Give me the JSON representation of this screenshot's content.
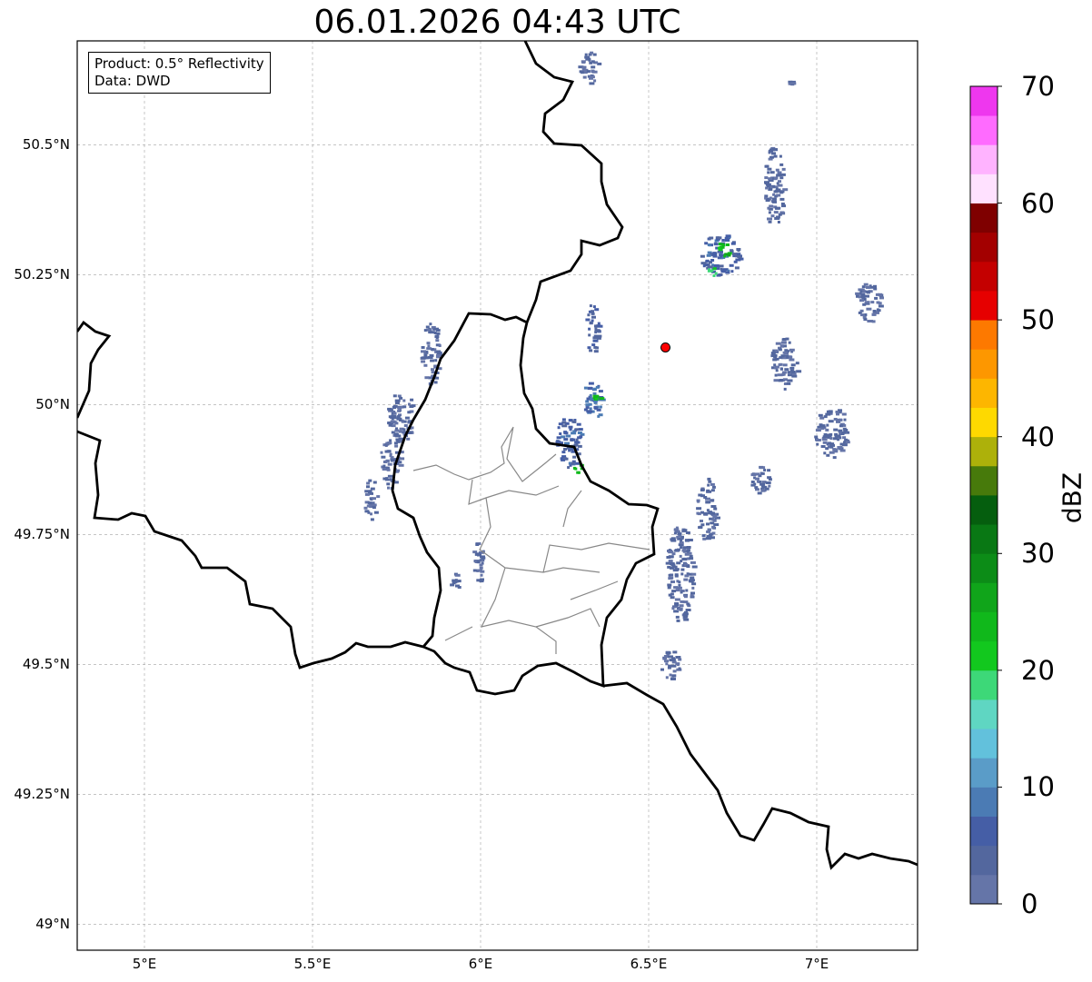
{
  "title": "06.01.2026 04:43 UTC",
  "info_box": {
    "product": "Product: 0.5° Reflectivity",
    "data_source": "Data: DWD"
  },
  "map": {
    "lon_range": [
      4.8,
      7.3
    ],
    "lat_range": [
      48.95,
      50.7
    ],
    "grid": true,
    "lat_ticks": [
      {
        "value": 50.5,
        "label": "50.5°N"
      },
      {
        "value": 50.25,
        "label": "50.25°N"
      },
      {
        "value": 50.0,
        "label": "50°N"
      },
      {
        "value": 49.75,
        "label": "49.75°N"
      },
      {
        "value": 49.5,
        "label": "49.5°N"
      },
      {
        "value": 49.25,
        "label": "49.25°N"
      },
      {
        "value": 49.0,
        "label": "49°N"
      }
    ],
    "lon_ticks": [
      {
        "value": 5.0,
        "label": "5°E"
      },
      {
        "value": 5.5,
        "label": "5.5°E"
      },
      {
        "value": 6.0,
        "label": "6°E"
      },
      {
        "value": 6.5,
        "label": "6.5°E"
      },
      {
        "value": 7.0,
        "label": "7°E"
      }
    ],
    "radar_site": {
      "lon": 6.55,
      "lat": 50.11,
      "color": "#ff0000"
    },
    "echo_regions": [
      {
        "lon": 5.76,
        "lat": 49.98,
        "rlon": 0.04,
        "rlat": 0.05,
        "dbz": 3
      },
      {
        "lon": 5.73,
        "lat": 49.9,
        "rlon": 0.03,
        "rlat": 0.06,
        "dbz": 3
      },
      {
        "lon": 5.67,
        "lat": 49.82,
        "rlon": 0.02,
        "rlat": 0.04,
        "dbz": 3
      },
      {
        "lon": 5.85,
        "lat": 50.1,
        "rlon": 0.03,
        "rlat": 0.06,
        "dbz": 3
      },
      {
        "lon": 5.99,
        "lat": 49.7,
        "rlon": 0.02,
        "rlat": 0.04,
        "dbz": 3
      },
      {
        "lon": 5.92,
        "lat": 49.66,
        "rlon": 0.015,
        "rlat": 0.02,
        "dbz": 3
      },
      {
        "lon": 6.33,
        "lat": 50.15,
        "rlon": 0.02,
        "rlat": 0.05,
        "dbz": 5
      },
      {
        "lon": 6.33,
        "lat": 50.01,
        "rlon": 0.03,
        "rlat": 0.04,
        "dbz": 8
      },
      {
        "lon": 6.26,
        "lat": 49.93,
        "rlon": 0.04,
        "rlat": 0.05,
        "dbz": 6
      },
      {
        "lon": 6.34,
        "lat": 50.02,
        "rlon": 0.015,
        "rlat": 0.01,
        "dbz": 24
      },
      {
        "lon": 6.29,
        "lat": 49.88,
        "rlon": 0.015,
        "rlat": 0.01,
        "dbz": 24
      },
      {
        "lon": 6.71,
        "lat": 50.29,
        "rlon": 0.06,
        "rlat": 0.04,
        "dbz": 6
      },
      {
        "lon": 6.72,
        "lat": 50.3,
        "rlon": 0.02,
        "rlat": 0.015,
        "dbz": 24
      },
      {
        "lon": 6.69,
        "lat": 50.26,
        "rlon": 0.015,
        "rlat": 0.01,
        "dbz": 19
      },
      {
        "lon": 6.87,
        "lat": 50.42,
        "rlon": 0.03,
        "rlat": 0.08,
        "dbz": 3
      },
      {
        "lon": 6.59,
        "lat": 49.68,
        "rlon": 0.04,
        "rlat": 0.1,
        "dbz": 3
      },
      {
        "lon": 6.67,
        "lat": 49.8,
        "rlon": 0.03,
        "rlat": 0.06,
        "dbz": 3
      },
      {
        "lon": 6.56,
        "lat": 49.5,
        "rlon": 0.03,
        "rlat": 0.03,
        "dbz": 3
      },
      {
        "lon": 7.04,
        "lat": 49.95,
        "rlon": 0.05,
        "rlat": 0.05,
        "dbz": 3
      },
      {
        "lon": 6.9,
        "lat": 50.08,
        "rlon": 0.04,
        "rlat": 0.05,
        "dbz": 3
      },
      {
        "lon": 7.15,
        "lat": 50.2,
        "rlon": 0.04,
        "rlat": 0.04,
        "dbz": 3
      },
      {
        "lon": 6.83,
        "lat": 49.86,
        "rlon": 0.03,
        "rlat": 0.03,
        "dbz": 3
      },
      {
        "lon": 6.92,
        "lat": 50.62,
        "rlon": 0.0,
        "rlat": 0.0,
        "dbz": 3
      },
      {
        "lon": 6.32,
        "lat": 50.65,
        "rlon": 0.03,
        "rlat": 0.03,
        "dbz": 3
      }
    ]
  },
  "colorbar": {
    "label": "dBZ",
    "range": [
      0,
      70
    ],
    "tick_values": [
      0,
      10,
      20,
      30,
      40,
      50,
      60,
      70
    ],
    "tick_labels": [
      "0",
      "10",
      "20",
      "30",
      "40",
      "50",
      "60",
      "70"
    ],
    "bins": [
      {
        "min": 0,
        "max": 2.5,
        "color": "#6575a8"
      },
      {
        "min": 2.5,
        "max": 5,
        "color": "#53679e"
      },
      {
        "min": 5,
        "max": 7.5,
        "color": "#455ea6"
      },
      {
        "min": 7.5,
        "max": 10,
        "color": "#4b7bb4"
      },
      {
        "min": 10,
        "max": 12.5,
        "color": "#5a9cc8"
      },
      {
        "min": 12.5,
        "max": 15,
        "color": "#62c1dc"
      },
      {
        "min": 15,
        "max": 17.5,
        "color": "#5fd6c2"
      },
      {
        "min": 17.5,
        "max": 20,
        "color": "#3dd878"
      },
      {
        "min": 20,
        "max": 22.5,
        "color": "#12c81e"
      },
      {
        "min": 22.5,
        "max": 25,
        "color": "#10b81b"
      },
      {
        "min": 25,
        "max": 27.5,
        "color": "#10a51a"
      },
      {
        "min": 27.5,
        "max": 30,
        "color": "#0c8c17"
      },
      {
        "min": 30,
        "max": 32.5,
        "color": "#097814"
      },
      {
        "min": 32.5,
        "max": 35,
        "color": "#055e0e"
      },
      {
        "min": 35,
        "max": 37.5,
        "color": "#477a0b"
      },
      {
        "min": 37.5,
        "max": 40,
        "color": "#adb10a"
      },
      {
        "min": 40,
        "max": 42.5,
        "color": "#fed900"
      },
      {
        "min": 42.5,
        "max": 45,
        "color": "#fdb600"
      },
      {
        "min": 45,
        "max": 47.5,
        "color": "#fd9700"
      },
      {
        "min": 47.5,
        "max": 50,
        "color": "#fd7900"
      },
      {
        "min": 50,
        "max": 52.5,
        "color": "#e60000"
      },
      {
        "min": 52.5,
        "max": 55,
        "color": "#c40000"
      },
      {
        "min": 55,
        "max": 57.5,
        "color": "#a30000"
      },
      {
        "min": 57.5,
        "max": 60,
        "color": "#7f0000"
      },
      {
        "min": 60,
        "max": 62.5,
        "color": "#ffe1ff"
      },
      {
        "min": 62.5,
        "max": 65,
        "color": "#ffb3ff"
      },
      {
        "min": 65,
        "max": 67.5,
        "color": "#ff6bff"
      },
      {
        "min": 67.5,
        "max": 70,
        "color": "#ee37ee"
      }
    ]
  }
}
